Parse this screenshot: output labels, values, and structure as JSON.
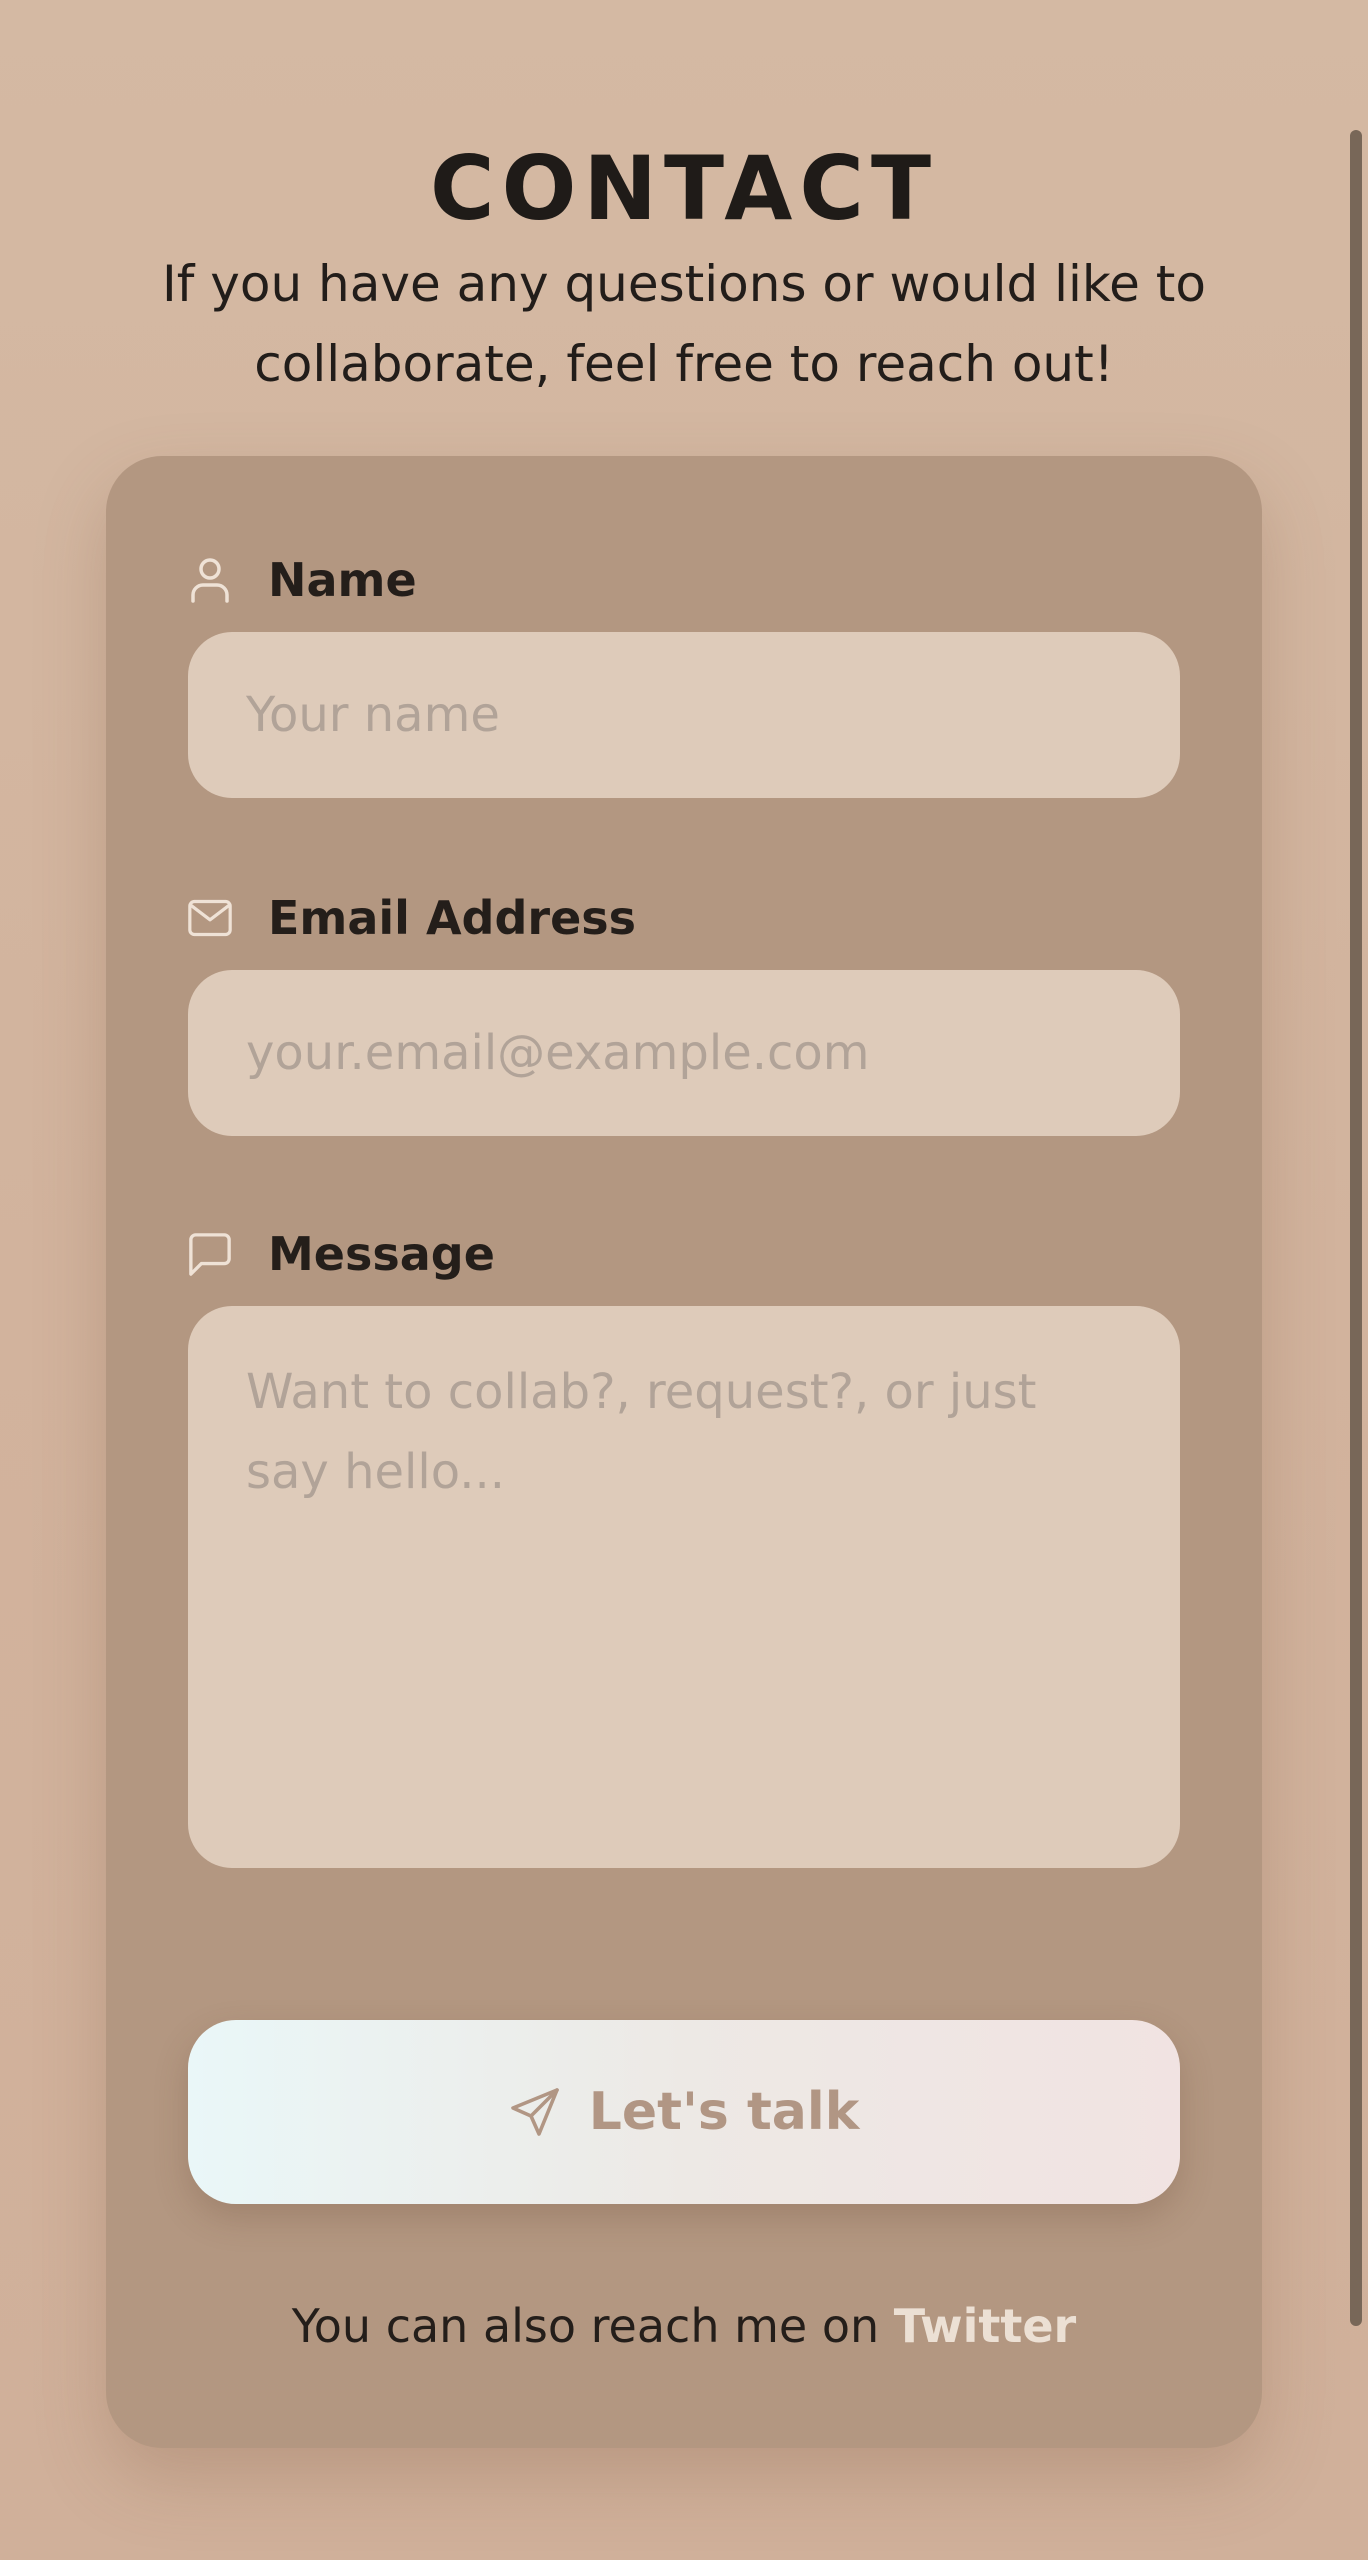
{
  "page": {
    "title": "CONTACT",
    "intro": "If you have any questions or would like to collaborate, feel free to reach out!"
  },
  "form": {
    "name": {
      "label": "Name",
      "icon": "user-icon",
      "value": "",
      "placeholder": "Your name"
    },
    "email": {
      "label": "Email Address",
      "icon": "mail-icon",
      "value": "",
      "placeholder": "your.email@example.com"
    },
    "message": {
      "label": "Message",
      "icon": "message-square-icon",
      "value": "",
      "placeholder": "Want to collab?, request?, or just say hello..."
    },
    "submit": {
      "label": "Let's talk",
      "icon": "send-icon"
    }
  },
  "footer": {
    "text": "You can also reach me on",
    "link_label": "Twitter"
  },
  "colors": {
    "background": "#d3b6a0",
    "card": "#b39781",
    "input": "#decbba",
    "text": "#221d1a",
    "link": "#ece0d4",
    "button_text": "#b19684"
  }
}
